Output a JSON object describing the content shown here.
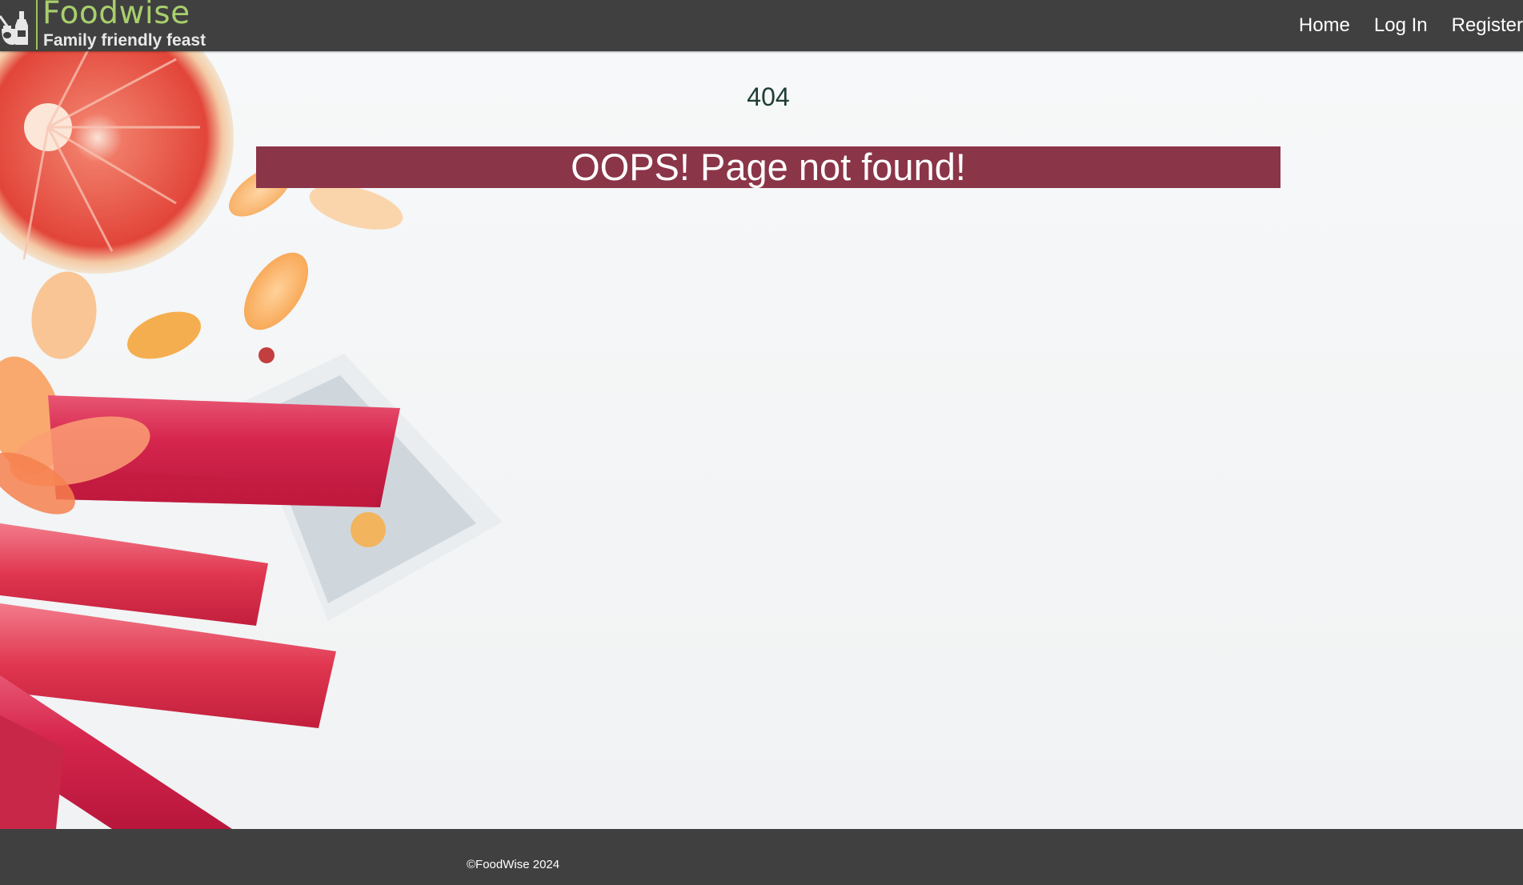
{
  "brand": {
    "title": "Foodwise",
    "tagline": "Family friendly feast"
  },
  "nav": {
    "links": [
      {
        "label": "Home"
      },
      {
        "label": "Log In"
      },
      {
        "label": "Register"
      }
    ]
  },
  "main": {
    "error_code": "404",
    "error_message": "OOPS! Page not found!"
  },
  "footer": {
    "copyright": "©FoodWise 2024"
  },
  "colors": {
    "navbar_bg": "#404040",
    "brand_green": "#a8cf6c",
    "banner_bg": "#8b3548",
    "error_code_text": "#1f3d33",
    "footer_bg": "#404040"
  },
  "icons": {
    "brand_logo": "kitchen-utensils-icon"
  }
}
